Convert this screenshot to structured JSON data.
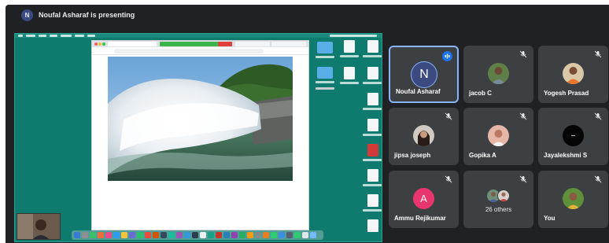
{
  "presenting": {
    "avatar_letter": "N",
    "text": "Noufal Asharaf is presenting"
  },
  "participants": [
    {
      "name": "Noufal Asharaf",
      "avatar": "N",
      "avatar_color": "#3c4a82",
      "speaking": true
    },
    {
      "name": "jacob C",
      "photo": true,
      "muted": true
    },
    {
      "name": "Yogesh Prasad",
      "photo": true,
      "muted": true
    },
    {
      "name": "jipsa joseph",
      "photo": true,
      "muted": true
    },
    {
      "name": "Gopika A",
      "photo": true,
      "muted": true
    },
    {
      "name": "Jayalekshmi S",
      "photo": true,
      "muted": true
    },
    {
      "name": "Ammu Rejikumar",
      "avatar": "A",
      "avatar_color": "#e8356d",
      "muted": true
    },
    {
      "name": "26 others",
      "stacked_photos": true,
      "muted": true
    },
    {
      "name": "You",
      "photo": true,
      "muted": true
    }
  ],
  "colors": {
    "background": "#202124",
    "tile": "#3c4043",
    "active_border": "#8ab4f8",
    "speaking_badge": "#1a73e8",
    "desktop": "#0f7a6e"
  },
  "icons": {
    "muted": "mic-off-icon",
    "speaking": "audio-levels-icon"
  }
}
